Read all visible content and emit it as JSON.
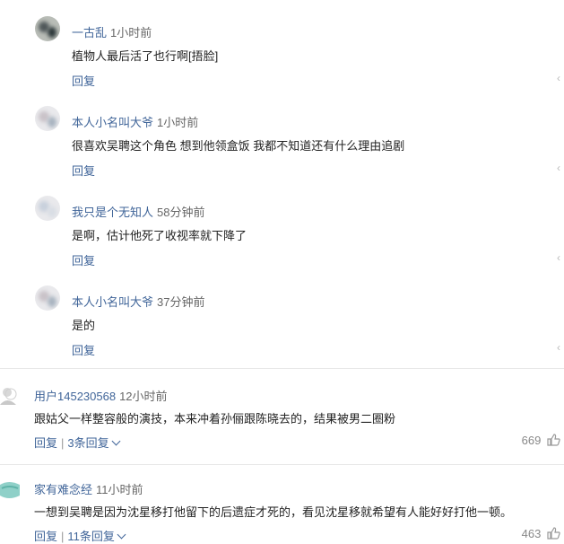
{
  "replies": [
    {
      "name": "一古乱",
      "time": "1小时前",
      "text": "植物人最后活了也行啊[捂脸]",
      "reply_label": "回复"
    },
    {
      "name": "本人小名叫大爷",
      "time": "1小时前",
      "text": "很喜欢吴聘这个角色 想到他领盒饭 我都不知道还有什么理由追剧",
      "reply_label": "回复"
    },
    {
      "name": "我只是个无知人",
      "time": "58分钟前",
      "text": "是啊，估计他死了收视率就下降了",
      "reply_label": "回复"
    },
    {
      "name": "本人小名叫大爷",
      "time": "37分钟前",
      "text": "是的",
      "reply_label": "回复"
    }
  ],
  "comments": [
    {
      "name": "用户145230568",
      "time": "12小时前",
      "text": "跟姑父一样整容般的演技，本来冲着孙俪跟陈晓去的，结果被男二圈粉",
      "reply_label": "回复",
      "replies_label": "3条回复",
      "likes": "669"
    },
    {
      "name": "家有难念经",
      "time": "11小时前",
      "text": "一想到吴聘是因为沈星移打他留下的后遗症才死的，看见沈星移就希望有人能好好打他一顿。",
      "reply_label": "回复",
      "replies_label": "11条回复",
      "likes": "463"
    }
  ],
  "colors": {
    "link": "#406599",
    "text": "#222222",
    "muted": "#888888"
  }
}
